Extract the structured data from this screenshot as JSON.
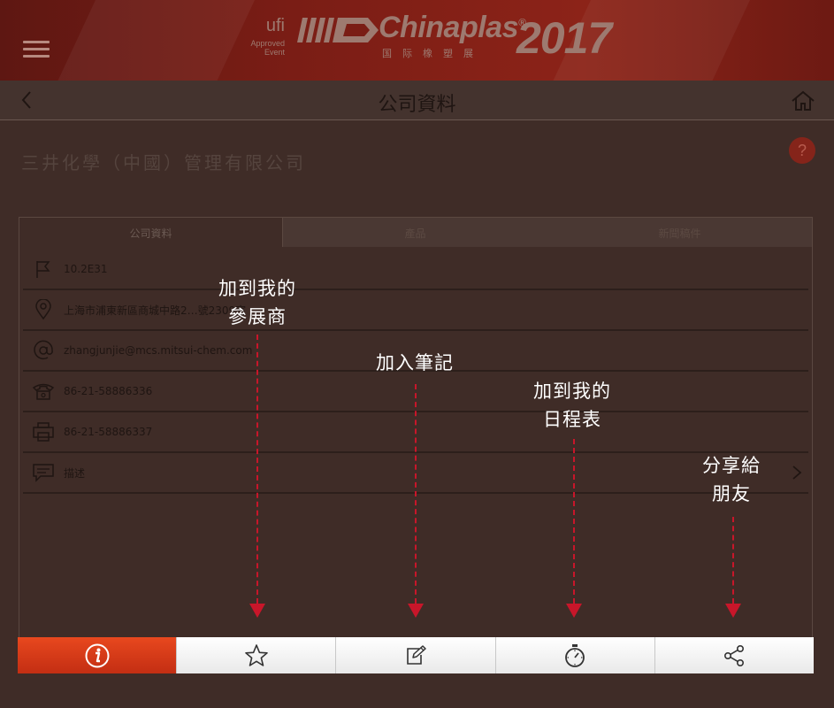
{
  "header": {
    "menu_icon": "hamburger-icon",
    "ufi_logo": "ufi",
    "ufi_line1": "Approved",
    "ufi_line2": "Event",
    "brand_name": "Chinaplas",
    "brand_registered": "®",
    "brand_subtitle": "国际橡塑展",
    "brand_year": "2017"
  },
  "titlebar": {
    "back_icon": "chevron-left-icon",
    "title": "公司資料",
    "home_icon": "home-icon"
  },
  "company": {
    "name": "三井化學（中國）管理有限公司",
    "help_label": "?"
  },
  "tabs": [
    {
      "label": "公司資料",
      "active": true
    },
    {
      "label": "產品",
      "active": false
    },
    {
      "label": "新聞稿件",
      "active": false
    }
  ],
  "details": [
    {
      "icon": "flag-icon",
      "text": "10.2E31"
    },
    {
      "icon": "location-pin-icon",
      "text": "上海市浦東新區商城中路2…號2309室"
    },
    {
      "icon": "at-sign-icon",
      "text": "zhangjunjie@mcs.mitsui-chem.com"
    },
    {
      "icon": "phone-icon",
      "text": "86-21-58886336"
    },
    {
      "icon": "fax-icon",
      "text": "86-21-58886337"
    },
    {
      "icon": "message-icon",
      "text": "描述"
    }
  ],
  "annotations": [
    {
      "line1": "加到我的",
      "line2": "參展商"
    },
    {
      "line1": "加入筆記",
      "line2": ""
    },
    {
      "line1": "加到我的",
      "line2": "日程表"
    },
    {
      "line1": "分享給",
      "line2": "朋友"
    }
  ],
  "toolbar": [
    {
      "icon": "info-icon",
      "active": true
    },
    {
      "icon": "star-icon",
      "active": false
    },
    {
      "icon": "note-edit-icon",
      "active": false
    },
    {
      "icon": "stopwatch-icon",
      "active": false
    },
    {
      "icon": "share-icon",
      "active": false
    }
  ],
  "colors": {
    "overlay_bg": "#3f2c27",
    "banner_red": "#8c2318",
    "active_tab_orange": "#e8481e",
    "arrow_red": "#c8162a"
  }
}
